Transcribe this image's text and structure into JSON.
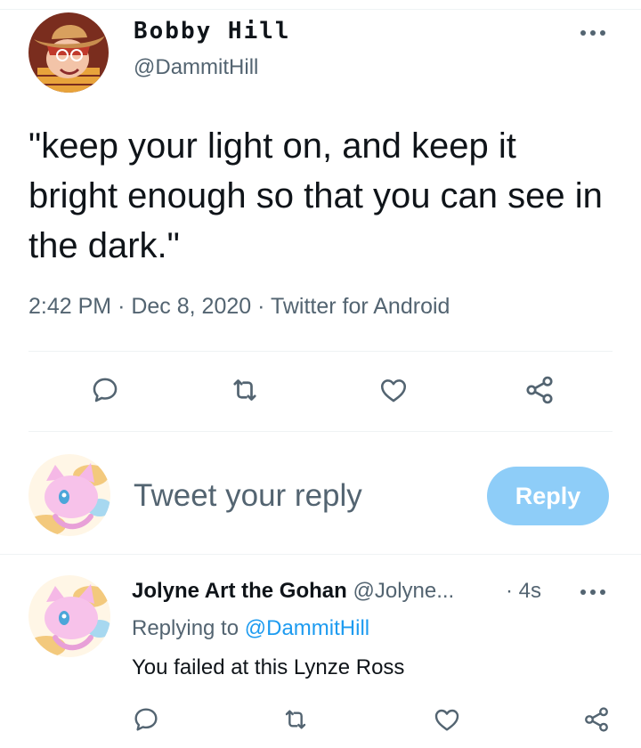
{
  "tweet": {
    "author": {
      "display_name": "Bobby Hill",
      "handle": "@DammitHill",
      "avatar": "cowboy-hat-avatar"
    },
    "text": "\"keep your light on, and keep it bright enough so that you can see in the dark.\"",
    "time": "2:42 PM",
    "date": "Dec 8, 2020",
    "source": "Twitter for Android",
    "separator": "·",
    "more_icon": "more-dots-icon",
    "actions": [
      "reply-icon",
      "retweet-icon",
      "like-icon",
      "share-icon"
    ]
  },
  "composer": {
    "avatar": "pink-cat-avatar",
    "placeholder": "Tweet your reply",
    "button_label": "Reply"
  },
  "reply": {
    "author_name": "Jolyne Art the Gohan",
    "author_handle": "@Jolyne...",
    "time": "· 4s",
    "replying_prefix": "Replying to",
    "replying_to": "@DammitHill",
    "text": "You failed at this Lynze Ross",
    "avatar": "pink-cat-avatar"
  },
  "colors": {
    "text": "#0f1419",
    "secondary": "#536471",
    "accent": "#1d9bf0",
    "button_disabled": "#8ecdf8",
    "divider": "#eff3f4"
  }
}
